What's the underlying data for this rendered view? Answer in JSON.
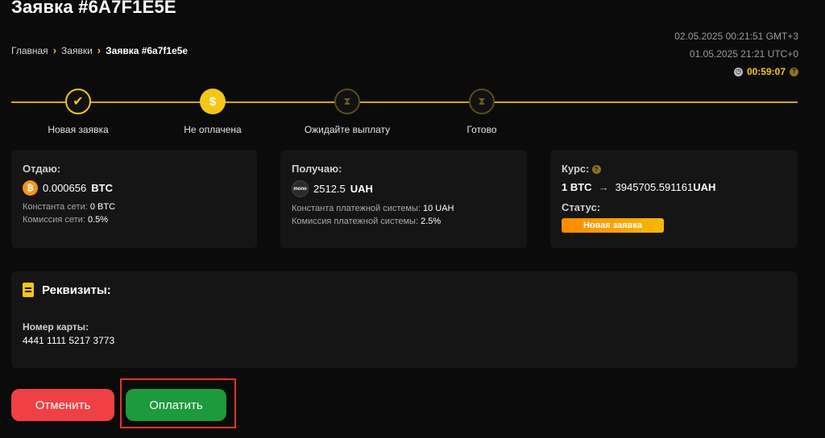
{
  "page": {
    "title": "Заявка #6A7F1E5E"
  },
  "breadcrumb": {
    "home": "Главная",
    "orders": "Заявки",
    "current": "Заявка #6a7f1e5e"
  },
  "times": {
    "local": "02.05.2025 00:21:51 GMT+3",
    "utc": "01.05.2025 21:21 UTC+0",
    "countdown": "00:59:07"
  },
  "steps": [
    {
      "label": "Новая заявка",
      "state": "done",
      "icon": "check-icon",
      "glyph": "✔"
    },
    {
      "label": "Не оплачена",
      "state": "active",
      "icon": "dollar-icon",
      "glyph": "$"
    },
    {
      "label": "Ожидайте выплату",
      "state": "pending",
      "icon": "hourglass-icon",
      "glyph": "⧗"
    },
    {
      "label": "Готово",
      "state": "pending",
      "icon": "hourglass-icon",
      "glyph": "⧗"
    }
  ],
  "give": {
    "heading": "Отдаю:",
    "amount": "0.000656",
    "currency": "BTC",
    "coin_glyph": "₿",
    "network_const_label": "Константа сети:",
    "network_const_value": "0 BTC",
    "network_fee_label": "Комиссия сети:",
    "network_fee_value": "0.5%"
  },
  "receive": {
    "heading": "Получаю:",
    "amount": "2512.5",
    "currency": "UAH",
    "coin_glyph": "mono",
    "system_const_label": "Константа платежной системы:",
    "system_const_value": "10 UAH",
    "system_fee_label": "Комиссия платежной системы:",
    "system_fee_value": "2.5%"
  },
  "rate": {
    "heading": "Курс:",
    "from": "1 BTC",
    "to": "3945705.591161",
    "to_currency": "UAH",
    "status_heading": "Статус:",
    "status": "Новая заявка"
  },
  "requisites": {
    "title": "Реквизиты:",
    "card_label": "Номер карты:",
    "card_number": "4441 1111 5217 3773"
  },
  "actions": {
    "cancel": "Отменить",
    "pay": "Оплатить"
  },
  "colors": {
    "accent": "#f5c518",
    "cancel": "#ee4045",
    "pay": "#1c9a3c",
    "highlight": "#e0352b"
  }
}
